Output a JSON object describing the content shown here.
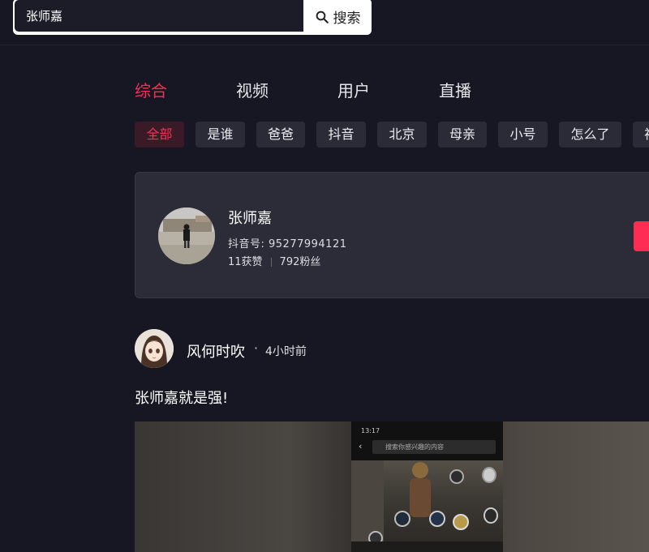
{
  "search": {
    "value": "张师嘉",
    "button_label": "搜索"
  },
  "tabs": [
    {
      "label": "综合",
      "active": true
    },
    {
      "label": "视频",
      "active": false
    },
    {
      "label": "用户",
      "active": false
    },
    {
      "label": "直播",
      "active": false
    }
  ],
  "filters": [
    "全部",
    "是谁",
    "爸爸",
    "抖音",
    "北京",
    "母亲",
    "小号",
    "怎么了",
    "视"
  ],
  "user_card": {
    "name": "张师嘉",
    "douyin_id": "抖音号: 95277994121",
    "likes": "11获赞",
    "fans": "792粉丝"
  },
  "post": {
    "author": "风何时吹",
    "dot": "·",
    "time": "4小时前",
    "text": "张师嘉就是强!",
    "video": {
      "status_time": "13:17",
      "search_hint": "搜索你感兴趣的内容"
    }
  },
  "colors": {
    "accent": "#fe2c55",
    "background": "#161722",
    "card": "#2b2c37",
    "chip": "#2a2b36"
  }
}
